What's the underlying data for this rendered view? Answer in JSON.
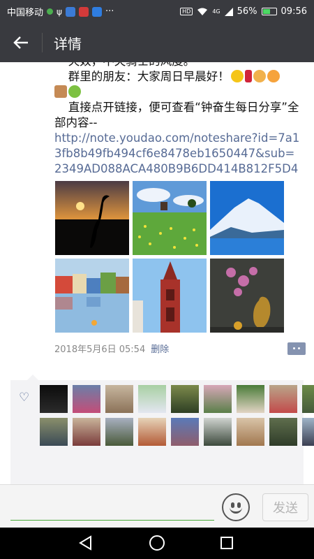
{
  "status_bar": {
    "carrier": "中国移动",
    "signal_label": "4G",
    "battery_percent": "56%",
    "battery_level": 0.56,
    "time": "09:56",
    "hd_label": "HD",
    "more": "···"
  },
  "header": {
    "back_icon": "arrow-left-icon",
    "title": "详情"
  },
  "post": {
    "line_partial": "天奴，不失骑士的风度。",
    "line_greeting": "群里的朋友：大家周日早晨好！",
    "line_link_intro": "直接点开链接，便可查看“钟奋生每日分享”全部内容--",
    "link": "http://note.youdao.com/noteshare?id=7a13fb8b49fb494cf6e8478eb1650447&sub=2349AD088ACA480B9B6DD414B812F5D4",
    "photos": [
      "sunset-crane",
      "green-meadow",
      "snow-mountain",
      "colorful-harbor",
      "brick-church-tower",
      "orchid-vase"
    ],
    "timestamp": "2018年5月6日 05:54",
    "delete_label": "删除"
  },
  "likes": {
    "icon": "heart-icon",
    "count": 19
  },
  "input_bar": {
    "emoji_icon": "smiley-icon",
    "send_label": "发送"
  },
  "colors": {
    "header_bg": "#393a3f",
    "link": "#576b95",
    "input_underline": "#4aaa3a"
  }
}
